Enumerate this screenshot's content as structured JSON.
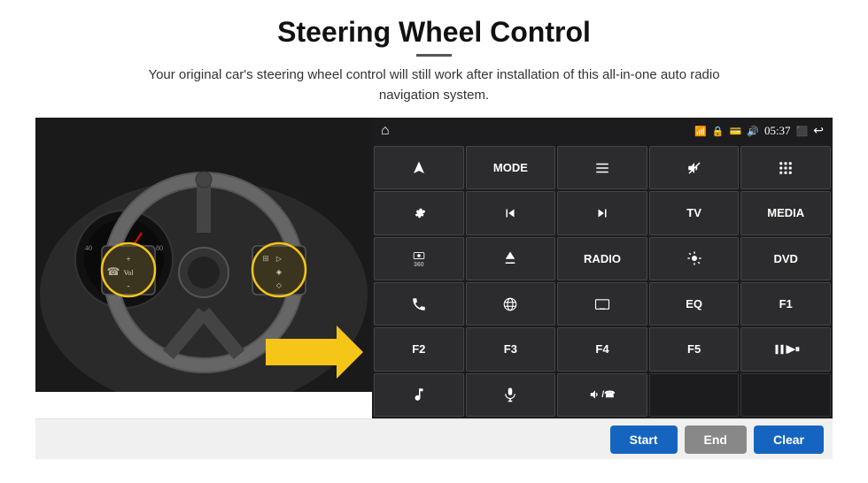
{
  "header": {
    "title": "Steering Wheel Control",
    "subtitle": "Your original car's steering wheel control will still work after installation of this all-in-one auto radio navigation system.",
    "divider": true
  },
  "status_bar": {
    "home_icon": "⌂",
    "wifi_icon": "wifi",
    "lock_icon": "🔒",
    "bt_icon": "bluetooth",
    "time": "05:37",
    "window_icon": "window",
    "back_icon": "↩"
  },
  "buttons": [
    {
      "id": "r1c1",
      "type": "icon",
      "icon": "navigate",
      "label": ""
    },
    {
      "id": "r1c2",
      "type": "text",
      "label": "MODE"
    },
    {
      "id": "r1c3",
      "type": "icon",
      "icon": "menu",
      "label": ""
    },
    {
      "id": "r1c4",
      "type": "icon",
      "icon": "mute",
      "label": ""
    },
    {
      "id": "r1c5",
      "type": "icon",
      "icon": "apps",
      "label": ""
    },
    {
      "id": "r2c1",
      "type": "icon",
      "icon": "settings",
      "label": ""
    },
    {
      "id": "r2c2",
      "type": "icon",
      "icon": "prev",
      "label": ""
    },
    {
      "id": "r2c3",
      "type": "icon",
      "icon": "next",
      "label": ""
    },
    {
      "id": "r2c4",
      "type": "text",
      "label": "TV"
    },
    {
      "id": "r2c5",
      "type": "text",
      "label": "MEDIA"
    },
    {
      "id": "r3c1",
      "type": "icon",
      "icon": "360cam",
      "label": ""
    },
    {
      "id": "r3c2",
      "type": "icon",
      "icon": "eject",
      "label": ""
    },
    {
      "id": "r3c3",
      "type": "text",
      "label": "RADIO"
    },
    {
      "id": "r3c4",
      "type": "icon",
      "icon": "brightness",
      "label": ""
    },
    {
      "id": "r3c5",
      "type": "text",
      "label": "DVD"
    },
    {
      "id": "r4c1",
      "type": "icon",
      "icon": "phone",
      "label": ""
    },
    {
      "id": "r4c2",
      "type": "icon",
      "icon": "web",
      "label": ""
    },
    {
      "id": "r4c3",
      "type": "icon",
      "icon": "screen",
      "label": ""
    },
    {
      "id": "r4c4",
      "type": "text",
      "label": "EQ"
    },
    {
      "id": "r4c5",
      "type": "text",
      "label": "F1"
    },
    {
      "id": "r5c1",
      "type": "text",
      "label": "F2"
    },
    {
      "id": "r5c2",
      "type": "text",
      "label": "F3"
    },
    {
      "id": "r5c3",
      "type": "text",
      "label": "F4"
    },
    {
      "id": "r5c4",
      "type": "text",
      "label": "F5"
    },
    {
      "id": "r5c5",
      "type": "icon",
      "icon": "playpause",
      "label": ""
    },
    {
      "id": "r6c1",
      "type": "icon",
      "icon": "music",
      "label": ""
    },
    {
      "id": "r6c2",
      "type": "icon",
      "icon": "mic",
      "label": ""
    },
    {
      "id": "r6c3",
      "type": "icon",
      "icon": "volphone",
      "label": ""
    },
    {
      "id": "r6c4",
      "type": "empty",
      "label": ""
    },
    {
      "id": "r6c5",
      "type": "empty",
      "label": ""
    }
  ],
  "action_bar": {
    "start_label": "Start",
    "end_label": "End",
    "clear_label": "Clear"
  }
}
